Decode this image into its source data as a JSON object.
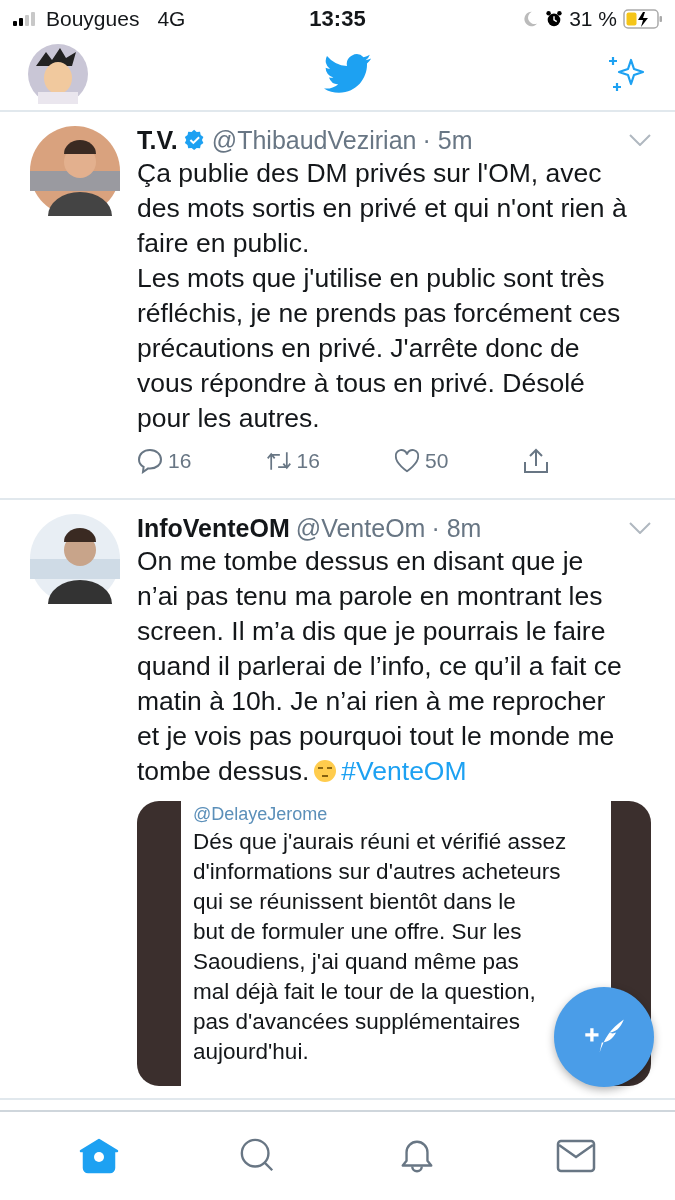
{
  "status_bar": {
    "carrier": "Bouygues",
    "network": "4G",
    "time": "13:35",
    "battery": "31 %"
  },
  "tweets": [
    {
      "name": "T.V.",
      "verified": true,
      "handle": "@ThibaudVezirian",
      "time": "· 5m",
      "text": "Ça publie des DM privés sur l'OM, avec des mots sortis en privé et qui n'ont rien à faire en public.\nLes mots que j'utilise en public sont très réfléchis, je ne prends pas forcément ces précautions en privé. J'arrête donc de vous répondre à tous en privé. Désolé pour les autres.",
      "replies": "16",
      "retweets": "16",
      "likes": "50"
    },
    {
      "name": "InfoVenteOM",
      "handle": "@VenteOm",
      "time": "· 8m",
      "text": "On me tombe dessus en disant que je n’ai pas tenu ma parole en montrant les screen. Il m’a dis que je pourrais le faire quand il parlerai de l’info, ce qu’il a fait ce matin à 10h. Je n’ai rien à me reprocher et je vois pas pourquoi tout le monde me tombe dessus.",
      "emoji": true,
      "hashtag": "#VenteOM",
      "embed": {
        "mention": "@DelayeJerome",
        "text": "Dés que j'aurais réuni et vérifié assez\nd'informations sur d'autres acheteurs\nqui se réunissent bientôt dans le\nbut de formuler une offre. Sur les\nSaoudiens, j'ai quand même pas\nmal déjà fait le tour de la question,\npas d'avancées supplémentaires\naujourd'hui."
      }
    }
  ],
  "tab_bar": [
    {
      "kind": "home",
      "selected": true
    },
    {
      "kind": "search",
      "selected": false
    },
    {
      "kind": "notifications",
      "selected": false
    },
    {
      "kind": "messages",
      "selected": false
    }
  ]
}
